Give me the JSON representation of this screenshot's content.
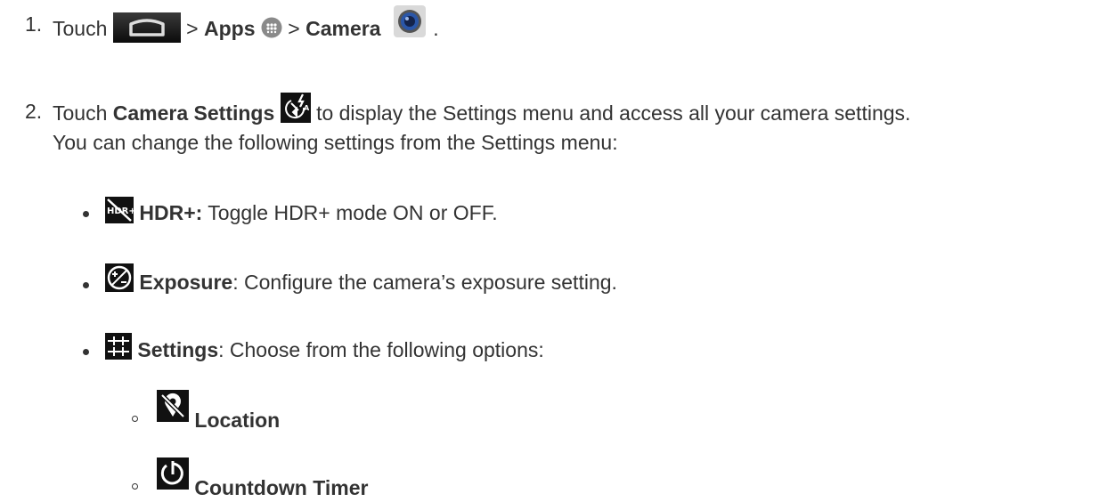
{
  "steps": [
    {
      "number": "1.",
      "touch": "Touch",
      "sep1": ">",
      "apps": "Apps",
      "sep2": ">",
      "camera": "Camera",
      "end": "."
    },
    {
      "number": "2.",
      "touch": "Touch",
      "camera_settings": "Camera Settings",
      "rest": "to display the Settings menu and access all your camera settings.",
      "line2": "You can change the following settings from the Settings menu:"
    }
  ],
  "settings": [
    {
      "icon": "hdr-plus-off-icon",
      "label": "HDR+:",
      "desc": "Toggle HDR+ mode ON or OFF."
    },
    {
      "icon": "exposure-icon",
      "label": "Exposure",
      "desc": ": Configure the camera’s exposure setting."
    },
    {
      "icon": "tune-settings-icon",
      "label": "Settings",
      "desc": ": Choose from the following options:"
    }
  ],
  "options": [
    {
      "icon": "location-off-icon",
      "label": "Location"
    },
    {
      "icon": "countdown-timer-icon",
      "label": "Countdown Timer"
    }
  ]
}
